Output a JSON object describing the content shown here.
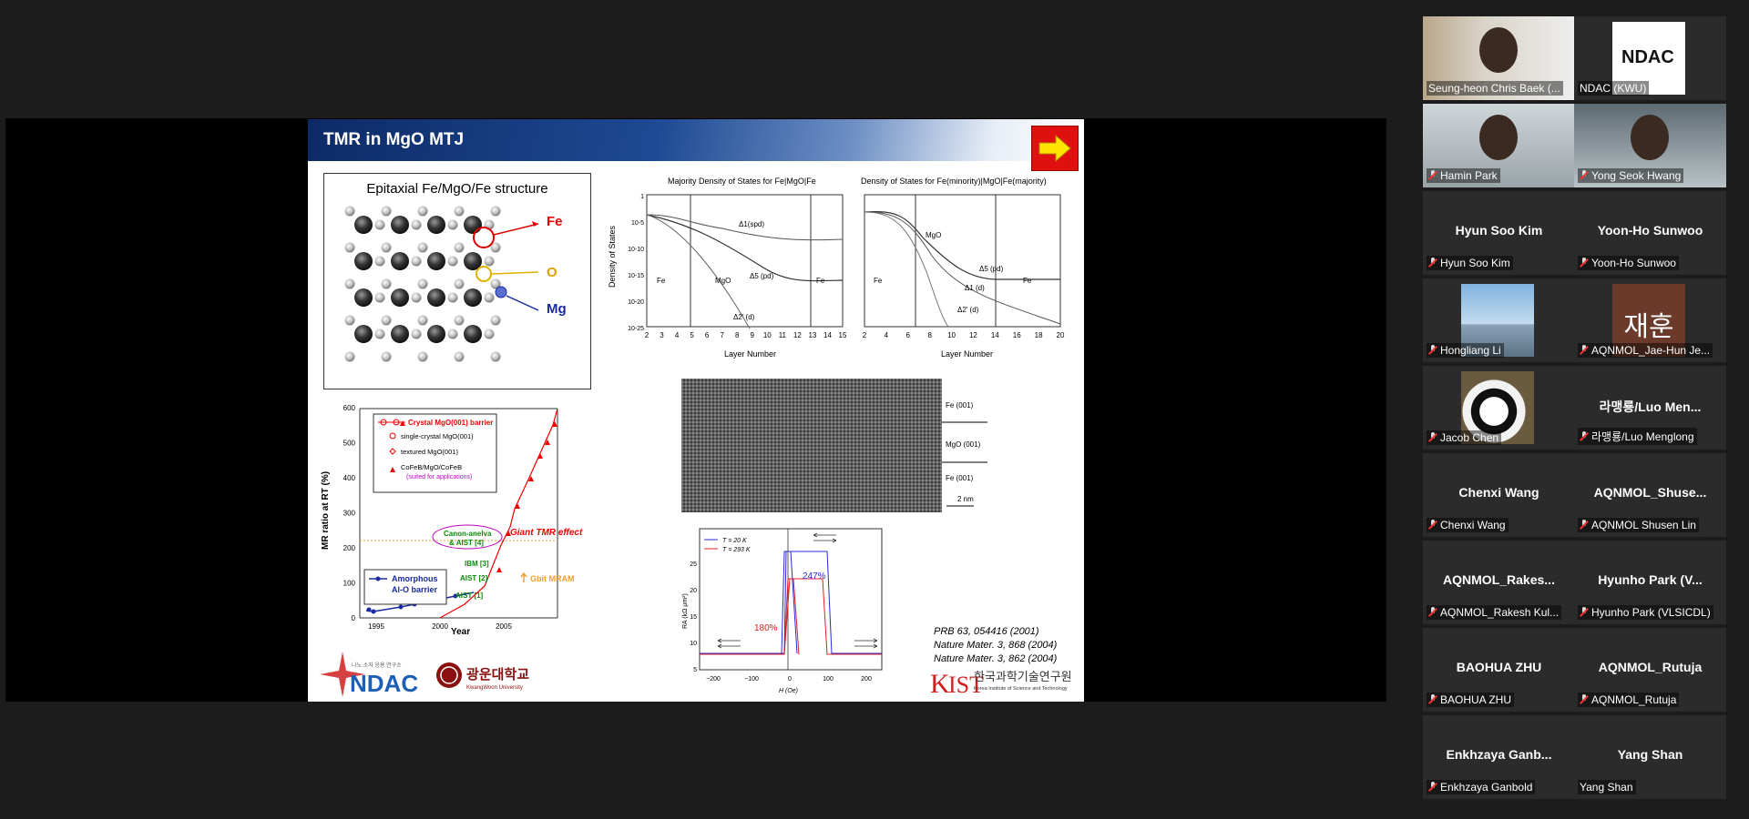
{
  "slide": {
    "title": "TMR in MgO MTJ",
    "epitaxial": {
      "title": "Epitaxial Fe/MgO/Fe structure",
      "label_fe": "Fe",
      "label_o": "O",
      "label_mg": "Mg"
    },
    "dos_left": {
      "title": "Majority Density of States for Fe|MgO|Fe",
      "ylabel": "Density of States",
      "xlabel": "Layer Number",
      "yticks": [
        "1",
        "10-5",
        "10-10",
        "10-15",
        "10-20",
        "10-25"
      ],
      "xticks": [
        "2",
        "3",
        "4",
        "5",
        "6",
        "7",
        "8",
        "9",
        "10",
        "11",
        "12",
        "13",
        "14",
        "15"
      ],
      "labels": [
        "Δ1(spd)",
        "Δ5 (pd)",
        "Δ2' (d)",
        "Fe",
        "MgO",
        "Fe"
      ]
    },
    "dos_right": {
      "title": "Density of States for Fe(minority)|MgO|Fe(majority)",
      "xlabel": "Layer Number",
      "xticks": [
        "2",
        "4",
        "6",
        "8",
        "10",
        "12",
        "14",
        "16",
        "18",
        "20"
      ],
      "labels": [
        "MgO",
        "Δ5 (pd)",
        "Δ1 (d)",
        "Δ2' (d)",
        "Fe",
        "Fe"
      ]
    },
    "tem": {
      "labels": [
        "Fe (001)",
        "MgO (001)",
        "Fe (001)",
        "2 nm"
      ]
    },
    "mr_chart": {
      "ylabel": "MR ratio at RT (%)",
      "xlabel": "Year",
      "yticks": [
        "0",
        "100",
        "200",
        "300",
        "400",
        "500",
        "600"
      ],
      "xticks": [
        "1995",
        "2000",
        "2005"
      ],
      "legend": [
        "Crystal MgO(001) barrier",
        "single-crystal  MgO(001)",
        "textured MgO(001)",
        "CoFeB/MgO/CoFeB",
        "(suited for applications)"
      ],
      "amorphous_label": "Amorphous\nAl-O barrier",
      "annotations": [
        "Canon-anelva\n& AIST [4]",
        "Giant TMR effect",
        "IBM [3]",
        "AIST [2]",
        "AIST [1]",
        "Gbit MRAM"
      ]
    },
    "rh_chart": {
      "ylabel": "RA (kΩ μm²)",
      "xlabel": "H (Oe)",
      "yticks": [
        "5",
        "10",
        "15",
        "20",
        "25"
      ],
      "xticks": [
        "−200",
        "−100",
        "0",
        "100",
        "200"
      ],
      "legend": [
        "T = 20 K",
        "T = 293 K"
      ],
      "value_high": "247%",
      "value_low": "180%"
    },
    "references": [
      "PRB 63, 054416 (2001)",
      "Nature Mater. 3, 868 (2004)",
      "Nature Mater. 3, 862 (2004)"
    ],
    "logos": {
      "ndac_tagline": "나노 소자 응용 연구소",
      "ndac": "NDAC",
      "kwu": "광운대학교",
      "kwu_sub": "KwangWoon University",
      "kist": "한국과학기술연구원",
      "kist_sub": "Korea Institute of Science and Technology"
    }
  },
  "participants": [
    {
      "name": "",
      "label": "Seung-heon Chris Baek (...",
      "muted": false,
      "active": true,
      "kind": "photo"
    },
    {
      "name": "",
      "label": "NDAC (KWU)",
      "muted": false,
      "kind": "logo"
    },
    {
      "name": "",
      "label": "Hamin Park",
      "muted": true,
      "kind": "photo"
    },
    {
      "name": "",
      "label": "Yong Seok Hwang",
      "muted": true,
      "kind": "photo"
    },
    {
      "name": "Hyun Soo Kim",
      "label": "Hyun Soo Kim",
      "muted": true
    },
    {
      "name": "Yoon-Ho Sunwoo",
      "label": "Yoon-Ho Sunwoo",
      "muted": true
    },
    {
      "name": "",
      "label": "Hongliang Li",
      "muted": true,
      "kind": "sky"
    },
    {
      "name": "재훈",
      "label": "AQNMOL_Jae-Hun Je...",
      "muted": true,
      "kind": "text-avatar"
    },
    {
      "name": "",
      "label": "Jacob Chen",
      "muted": true,
      "kind": "panda"
    },
    {
      "name": "라맹룡/Luo Men...",
      "label": "라맹룡/Luo Menglong",
      "muted": true
    },
    {
      "name": "Chenxi Wang",
      "label": "Chenxi Wang",
      "muted": true
    },
    {
      "name": "AQNMOL_Shuse...",
      "label": "AQNMOL Shusen Lin",
      "muted": true
    },
    {
      "name": "AQNMOL_Rakes...",
      "label": "AQNMOL_Rakesh Kul...",
      "muted": true
    },
    {
      "name": "Hyunho Park (V...",
      "label": "Hyunho Park (VLSICDL)",
      "muted": true
    },
    {
      "name": "BAOHUA ZHU",
      "label": "BAOHUA ZHU",
      "muted": true
    },
    {
      "name": "AQNMOL_Rutuja",
      "label": "AQNMOL_Rutuja",
      "muted": true
    },
    {
      "name": "Enkhzaya  Ganb...",
      "label": "Enkhzaya Ganbold",
      "muted": true
    },
    {
      "name": "Yang Shan",
      "label": "Yang Shan",
      "muted": false
    }
  ]
}
